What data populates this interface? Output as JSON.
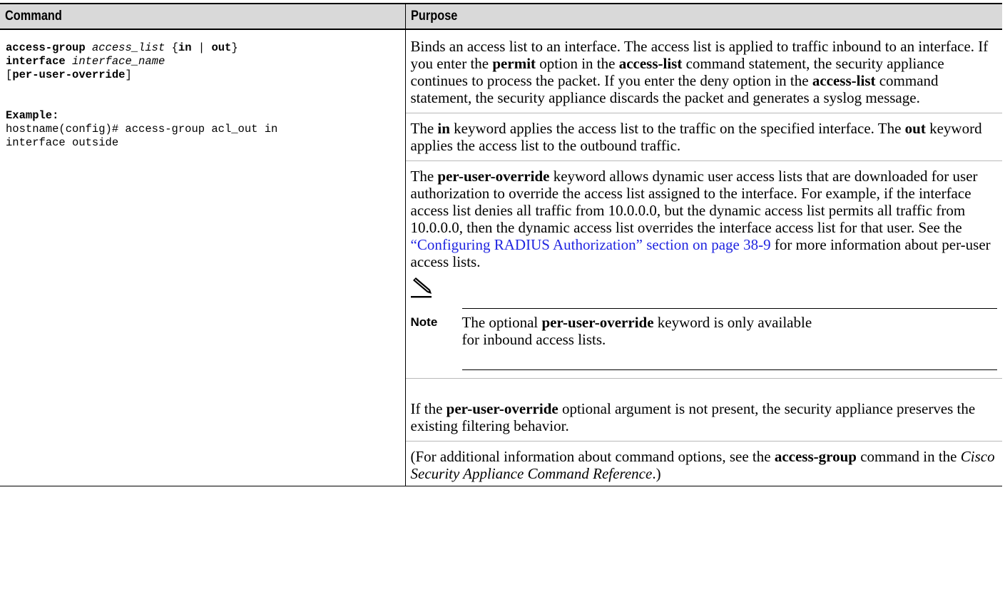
{
  "table": {
    "header": {
      "command": "Command",
      "purpose": "Purpose"
    },
    "command": {
      "line1": {
        "kw1": "access-group",
        "arg1": "access_list",
        "open": "{",
        "kw2": "in",
        "pipe": "|",
        "kw3": "out",
        "close": "}"
      },
      "line2": {
        "kw": "interface",
        "arg": "interface_name"
      },
      "line3": {
        "open": "[",
        "kw": "per-user-override",
        "close": "]"
      },
      "example_label": "Example:",
      "example_line1": "hostname(config)# access-group acl_out in",
      "example_line2": "interface outside"
    },
    "purpose": {
      "p1": {
        "t1": "Binds an access list to an interface. The access list is applied to traffic inbound to an interface. If you enter the ",
        "b1": "permit",
        "t2": " option in the ",
        "b2": "access-list",
        "t3": " command statement, the security appliance continues to process the packet. If you enter the deny option in the ",
        "b3": "access-list",
        "t4": " command statement, the security appliance discards the packet and generates a syslog message."
      },
      "p2": {
        "t1": "The ",
        "b1": "in",
        "t2": " keyword applies the access list to the traffic on the specified interface. The ",
        "b2": "out",
        "t3": " keyword applies the access list to the outbound traffic."
      },
      "p3": {
        "t1": "The ",
        "b1": "per-user-override",
        "t2": " keyword allows dynamic user access lists that are downloaded for user authorization to override the access list assigned to the interface. For example, if the interface access list denies all traffic from 10.0.0.0, but the dynamic access list permits all traffic from 10.0.0.0, then the dynamic access list overrides the interface access list for that user. See the ",
        "link": "“Configuring RADIUS Authorization” section on page 38-9",
        "t3": " for more information about per-user access lists."
      },
      "note": {
        "label": "Note",
        "t1": "The optional ",
        "b1": "per-user-override",
        "t2": " keyword is only available for inbound access lists."
      },
      "p4": {
        "t1": "If the ",
        "b1": "per-user-override",
        "t2": " optional argument is not present, the security appliance preserves the existing filtering behavior."
      },
      "p5": {
        "t1": "(For additional information about command options, see the ",
        "b1": "access-group",
        "t2": " command in the ",
        "i1": "Cisco Security Appliance Command Reference",
        "t3": ".)"
      }
    }
  },
  "icons": {
    "note": "pencil-note-icon"
  },
  "colors": {
    "header_bg": "#d9d9d9",
    "link": "#1f24e0"
  }
}
